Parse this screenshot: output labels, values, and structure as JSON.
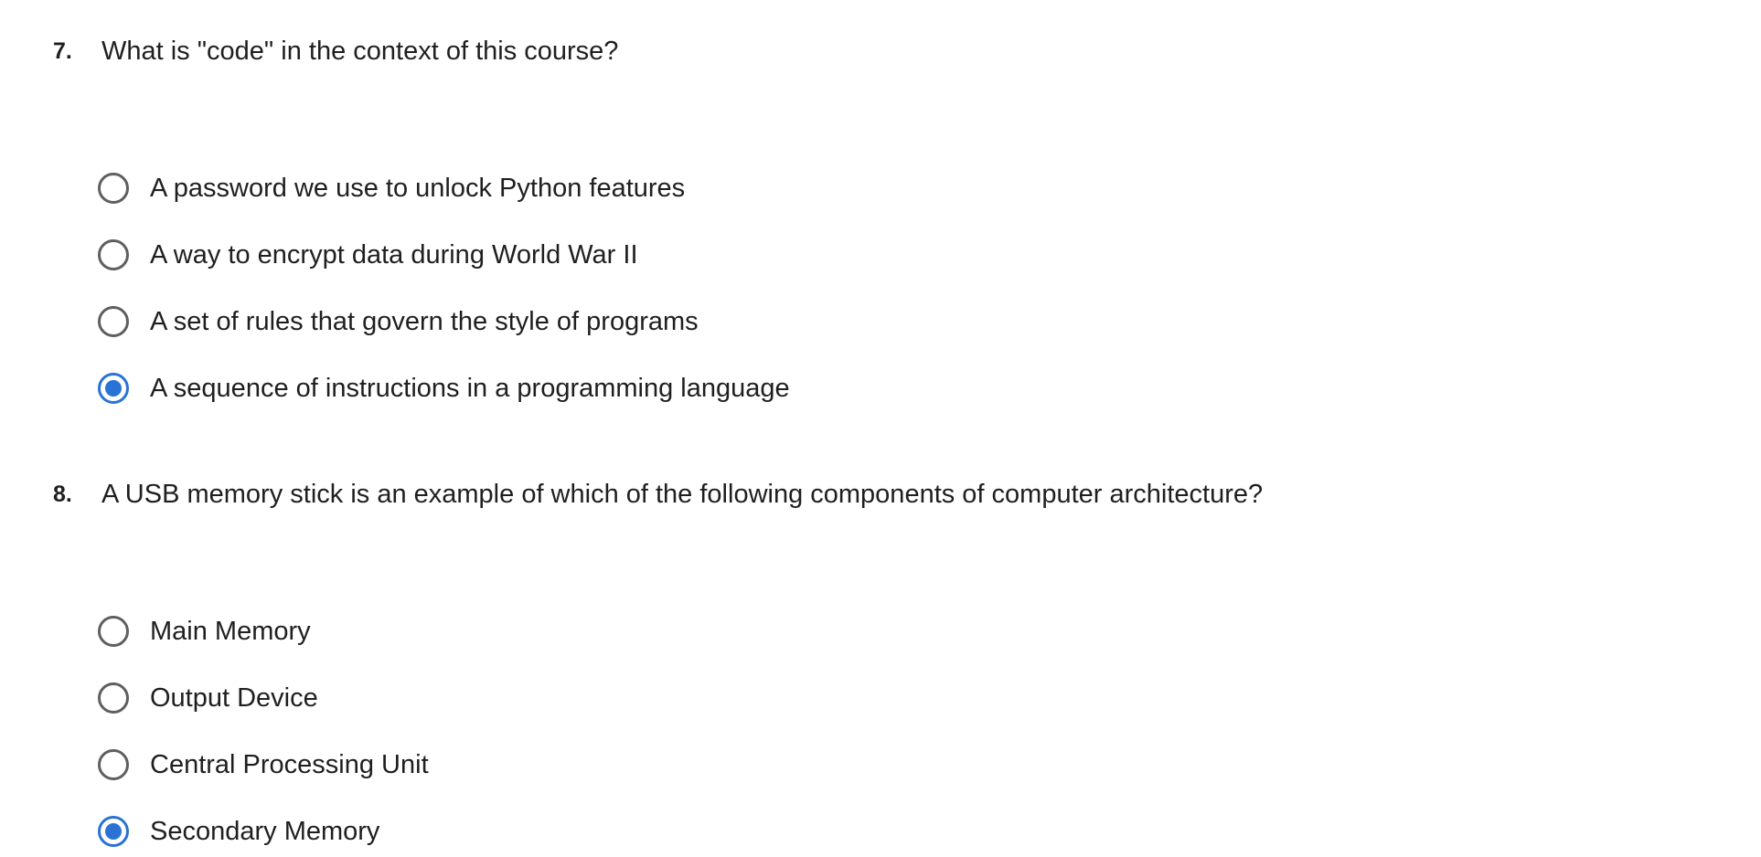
{
  "questions": [
    {
      "number": "7.",
      "text": "What is \"code\" in the context of this course?",
      "options": [
        {
          "label": "A password we use to unlock Python features",
          "selected": false
        },
        {
          "label": "A way to encrypt data during World War II",
          "selected": false
        },
        {
          "label": "A set of rules that govern the style of programs",
          "selected": false
        },
        {
          "label": "A sequence of instructions in a programming language",
          "selected": true
        }
      ]
    },
    {
      "number": "8.",
      "text": "A USB memory stick is an example of which of the following components of computer architecture?",
      "options": [
        {
          "label": "Main Memory",
          "selected": false
        },
        {
          "label": "Output Device",
          "selected": false
        },
        {
          "label": "Central Processing Unit",
          "selected": false
        },
        {
          "label": "Secondary Memory",
          "selected": true
        }
      ]
    }
  ],
  "colors": {
    "radio_selected": "#2a73d4",
    "radio_unselected": "#5f5f5f",
    "text": "#1f1f1f"
  }
}
